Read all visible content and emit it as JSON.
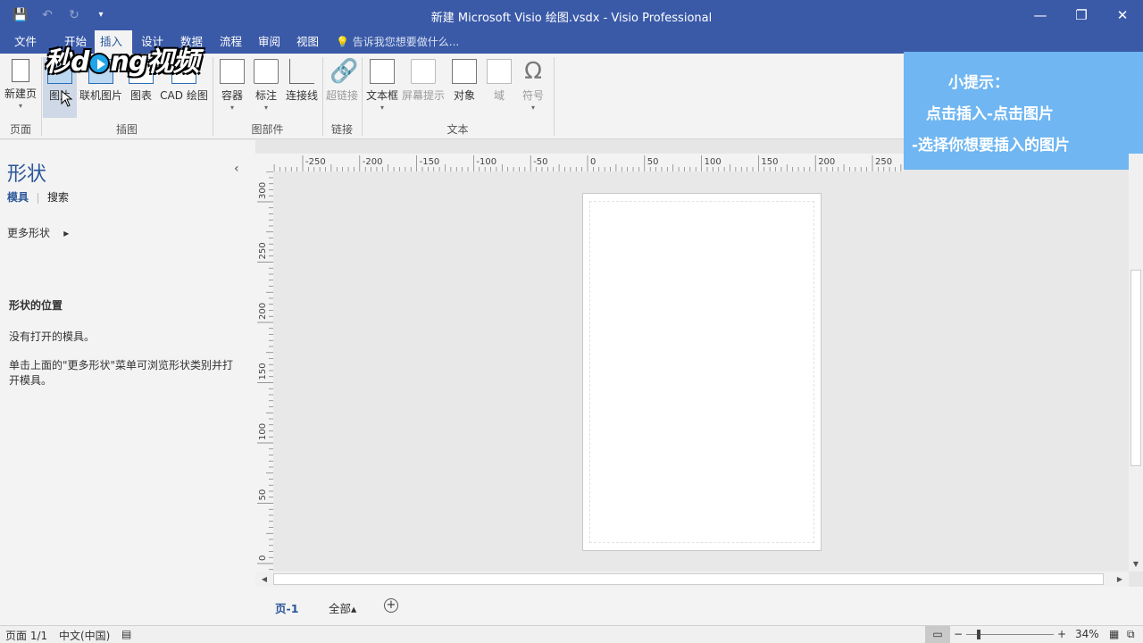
{
  "window": {
    "title": "新建 Microsoft Visio 绘图.vsdx - Visio Professional",
    "qat": {
      "save_icon": "save-icon",
      "undo_icon": "undo-icon",
      "redo_icon": "redo-icon",
      "customize_icon": "customize-qat-icon"
    },
    "controls": {
      "minimize": "—",
      "restore": "❐",
      "close": "✕"
    }
  },
  "menu": {
    "tabs": [
      "文件",
      "开始",
      "插入",
      "设计",
      "数据",
      "流程",
      "审阅",
      "视图"
    ],
    "active": "插入",
    "tell_me": "告诉我您想要做什么..."
  },
  "watermark": {
    "text_a": "秒",
    "text_b": "d",
    "text_c": "ng视频"
  },
  "ribbon": {
    "buttons": {
      "new_page": "新建页",
      "picture": "图片",
      "online_picture": "联机图片",
      "chart": "图表",
      "cad": "CAD 绘图",
      "container": "容器",
      "callout": "标注",
      "connector": "连接线",
      "hyperlink": "超链接",
      "textbox": "文本框",
      "screentip": "屏幕提示",
      "object": "对象",
      "field": "域",
      "symbol": "符号"
    },
    "groups": {
      "pages": "页面",
      "illustrations": "插图",
      "diagram_parts": "图部件",
      "links": "链接",
      "text": "文本"
    },
    "symbol_glyph": "Ω"
  },
  "tip": {
    "line1": "小提示：",
    "line2": "点击插入-点击图片",
    "line3": "-选择你想要插入的图片"
  },
  "shapes_pane": {
    "title": "形状",
    "tab_stencils": "模具",
    "tab_search": "搜索",
    "more_shapes": "更多形状",
    "more_arrow": "▸",
    "collapse": "‹",
    "heading": "形状的位置",
    "no_stencils": "没有打开的模具。",
    "instructions": "单击上面的\"更多形状\"菜单可浏览形状类别并打开模具。"
  },
  "ruler": {
    "h_labels": [
      "-250",
      "-200",
      "-150",
      "-100",
      "-50",
      "0",
      "50",
      "100",
      "150",
      "200",
      "250"
    ],
    "v_labels": [
      "300",
      "250",
      "200",
      "150",
      "100",
      "50",
      "0"
    ]
  },
  "page_tabs": {
    "page1": "页-1",
    "all": "全部▴",
    "add": "+"
  },
  "status": {
    "page": "页面 1/1",
    "language": "中文(中国)",
    "zoom": "34%",
    "zoom_minus": "−",
    "zoom_plus": "+"
  }
}
